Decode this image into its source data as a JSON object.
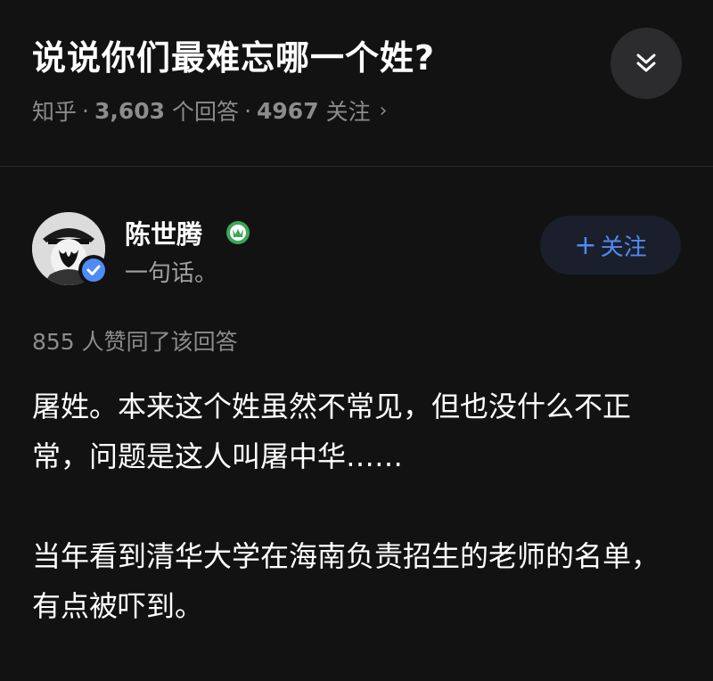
{
  "question": {
    "title": "说说你们最难忘哪一个姓?",
    "source": "知乎",
    "answers_count": "3,603",
    "answers_label": "个回答",
    "followers_count": "4967",
    "followers_label": "关注",
    "separator": "·",
    "chevron": "›"
  },
  "author": {
    "name": "陈世腾",
    "bio": "一句话。",
    "follow_label": "关注",
    "follow_plus": "+"
  },
  "answer": {
    "likes_text": "855 人赞同了该回答",
    "paragraphs": [
      "屠姓。本来这个姓虽然不常见，但也没什么不正常，问题是这人叫屠中华……",
      "当年看到清华大学在海南负责招生的老师的名单，有点被吓到。"
    ]
  },
  "icons": {
    "collapse": "chevron-double-down-icon",
    "verified": "verified-check-icon",
    "badge": "green-badge-icon"
  },
  "colors": {
    "background": "#121212",
    "accent_blue": "#4f8bf5",
    "muted_text": "#8c8c8c",
    "badge_green": "#3aa757"
  }
}
